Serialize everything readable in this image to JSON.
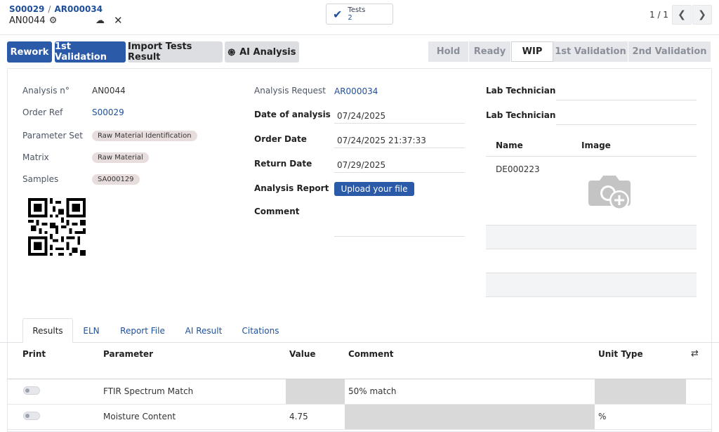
{
  "header": {
    "breadcrumb_order": "S00029",
    "breadcrumb_sep": "/",
    "breadcrumb_request": "AR000034",
    "record_name": "AN0044",
    "tests_label": "Tests",
    "tests_count": "2",
    "pager": "1 / 1"
  },
  "actions": {
    "rework": "Rework",
    "first_validation": "1st Validation",
    "import_tests": "Import Tests Result",
    "ai_analysis": "AI Analysis"
  },
  "stages": [
    "Hold",
    "Ready",
    "WIP",
    "1st Validation",
    "2nd Validation"
  ],
  "active_stage": "WIP",
  "form": {
    "analysis_no_label": "Analysis n°",
    "analysis_no": "AN0044",
    "order_ref_label": "Order Ref",
    "order_ref": "S00029",
    "parameter_set_label": "Parameter Set",
    "parameter_set": "Raw Material Identification",
    "matrix_label": "Matrix",
    "matrix": "Raw Material",
    "samples_label": "Samples",
    "samples": "SA000129",
    "analysis_request_label": "Analysis Request",
    "analysis_request": "AR000034",
    "date_of_analysis_label": "Date of analysis",
    "date_of_analysis": "07/24/2025",
    "order_date_label": "Order Date",
    "order_date": "07/24/2025 21:37:33",
    "return_date_label": "Return Date",
    "return_date": "07/29/2025",
    "analysis_report_label": "Analysis Report",
    "upload_label": "Upload your file",
    "comment_label": "Comment",
    "lab_tech_1_label": "Lab Technician",
    "lab_tech_2_label": "Lab Technician",
    "name_col": "Name",
    "image_col": "Image",
    "technician_name": "DE000223"
  },
  "tabs": [
    "Results",
    "ELN",
    "Report File",
    "AI Result",
    "Citations"
  ],
  "active_tab": "Results",
  "results_table": {
    "columns": [
      "Print",
      "Parameter",
      "Value",
      "Comment",
      "Unit Type"
    ],
    "rows": [
      {
        "parameter": "FTIR Spectrum Match",
        "value": "",
        "comment": "50% match",
        "unit": ""
      },
      {
        "parameter": "Moisture Content",
        "value": "4.75",
        "comment": "",
        "unit": "%"
      }
    ]
  }
}
